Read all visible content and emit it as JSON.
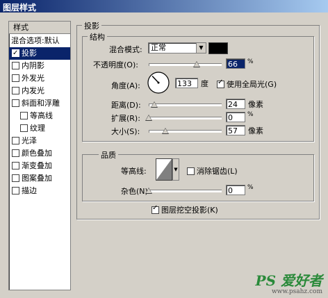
{
  "window": {
    "title": "图层样式"
  },
  "sidebar": {
    "header": "样式",
    "items": [
      {
        "label": "混合选项:默认",
        "checkbox": false,
        "checked": false,
        "selected": false,
        "indent": false
      },
      {
        "label": "投影",
        "checkbox": true,
        "checked": true,
        "selected": true,
        "indent": false
      },
      {
        "label": "内阴影",
        "checkbox": true,
        "checked": false,
        "selected": false,
        "indent": false
      },
      {
        "label": "外发光",
        "checkbox": true,
        "checked": false,
        "selected": false,
        "indent": false
      },
      {
        "label": "内发光",
        "checkbox": true,
        "checked": false,
        "selected": false,
        "indent": false
      },
      {
        "label": "斜面和浮雕",
        "checkbox": true,
        "checked": false,
        "selected": false,
        "indent": false
      },
      {
        "label": "等高线",
        "checkbox": true,
        "checked": false,
        "selected": false,
        "indent": true
      },
      {
        "label": "纹理",
        "checkbox": true,
        "checked": false,
        "selected": false,
        "indent": true
      },
      {
        "label": "光泽",
        "checkbox": true,
        "checked": false,
        "selected": false,
        "indent": false
      },
      {
        "label": "颜色叠加",
        "checkbox": true,
        "checked": false,
        "selected": false,
        "indent": false
      },
      {
        "label": "渐变叠加",
        "checkbox": true,
        "checked": false,
        "selected": false,
        "indent": false
      },
      {
        "label": "图案叠加",
        "checkbox": true,
        "checked": false,
        "selected": false,
        "indent": false
      },
      {
        "label": "描边",
        "checkbox": true,
        "checked": false,
        "selected": false,
        "indent": false
      }
    ]
  },
  "drop_shadow": {
    "title": "投影",
    "structure": {
      "title": "结构",
      "blend_mode_label": "混合模式:",
      "blend_mode_value": "正常",
      "shadow_color": "#000000",
      "opacity_label": "不透明度(O):",
      "opacity_value": "66",
      "opacity_unit": "%",
      "opacity_fraction": 0.66,
      "angle_label": "角度(A):",
      "angle_value": "133",
      "angle_unit": "度",
      "global_light_label": "使用全局光(G)",
      "global_light_checked": true,
      "distance_label": "距离(D):",
      "distance_value": "24",
      "distance_unit": "像素",
      "distance_fraction": 0.08,
      "spread_label": "扩展(R):",
      "spread_value": "0",
      "spread_unit": "%",
      "spread_fraction": 0.0,
      "size_label": "大小(S):",
      "size_value": "57",
      "size_unit": "像素",
      "size_fraction": 0.23
    },
    "quality": {
      "title": "品质",
      "contour_label": "等高线:",
      "antialias_label": "消除锯齿(L)",
      "antialias_checked": false,
      "noise_label": "杂色(N):",
      "noise_value": "0",
      "noise_unit": "%",
      "noise_fraction": 0.0
    },
    "knockout_label": "图层挖空投影(K)",
    "knockout_checked": true
  },
  "watermark": {
    "text": "PS 爱好者",
    "sub": "www.psahz.com"
  },
  "colors": {
    "titlebar": "#0a246a",
    "selection": "#0a246a",
    "dialog_bg": "#d4d0c8",
    "watermark": "#2a8a3a"
  }
}
